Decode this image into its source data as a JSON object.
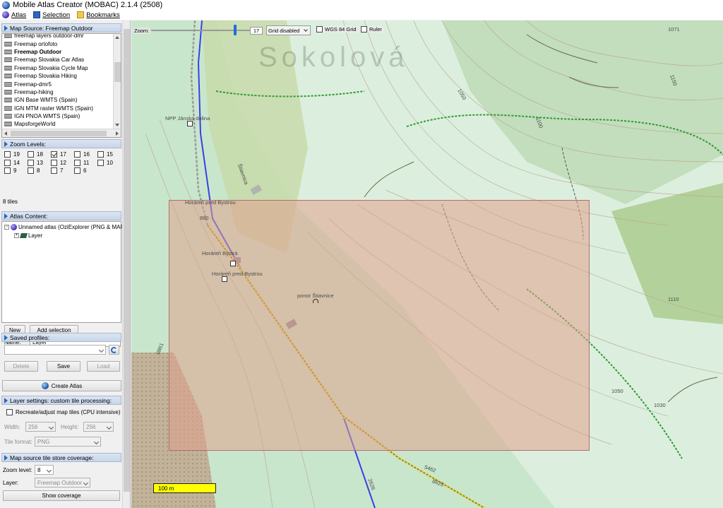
{
  "window": {
    "title": "Mobile Atlas Creator (MOBAC) 2.1.4 (2508)"
  },
  "menu": [
    {
      "label": "Atlas",
      "icon": "globe-icon"
    },
    {
      "label": "Selection",
      "icon": "selection-icon"
    },
    {
      "label": "Bookmarks",
      "icon": "bookmarks-icon"
    }
  ],
  "map_source": {
    "header": "Map Source: Freemap Outdoor",
    "items": [
      "freemap layers outdoor-dmr",
      "Freemap ortofoto",
      "Freemap Outdoor",
      "Freemap Slovakia Car Atlas",
      "Freemap Slovakia Cycle Map",
      "Freemap Slovakia Hiking",
      "Freemap-dmr5",
      "Freemap-hiking",
      "IGN Base WMTS (Spain)",
      "IGN MTM raster WMTS (Spain)",
      "IGN PNOA WMTS (Spain)",
      "MapsforgeWorld"
    ],
    "selected": "Freemap Outdoor"
  },
  "zoom_levels": {
    "header": "Zoom Levels:",
    "levels": [
      {
        "level": "19",
        "checked": false
      },
      {
        "level": "18",
        "checked": false
      },
      {
        "level": "17",
        "checked": true
      },
      {
        "level": "16",
        "checked": false
      },
      {
        "level": "15",
        "checked": false
      },
      {
        "level": "14",
        "checked": false
      },
      {
        "level": "13",
        "checked": false
      },
      {
        "level": "12",
        "checked": false
      },
      {
        "level": "11",
        "checked": false
      },
      {
        "level": "10",
        "checked": false
      },
      {
        "level": "9",
        "checked": false
      },
      {
        "level": "8",
        "checked": false
      },
      {
        "level": "7",
        "checked": false
      },
      {
        "level": "6",
        "checked": false
      }
    ],
    "tiles_text": "8 tiles"
  },
  "atlas_content": {
    "header": "Atlas Content:",
    "atlas_name": "Unnamed atlas (OziExplorer (PNG & MAP",
    "layer_node": "Layer",
    "new_button": "New",
    "add_selection_button": "Add selection",
    "name_label": "Name:",
    "name_value": "Layer"
  },
  "saved_profiles": {
    "header": "Saved profiles:",
    "profile_value": "",
    "delete_button": "Delete",
    "save_button": "Save",
    "load_button": "Load"
  },
  "create_atlas_button": "Create Atlas",
  "layer_settings": {
    "header": "Layer settings: custom tile processing:",
    "recreate_label": "Recreate/adjust map tiles (CPU intensive)",
    "width_label": "Width:",
    "width_value": "256",
    "height_label": "Height:",
    "height_value": "256",
    "tile_format_label": "Tile format:",
    "tile_format_value": "PNG"
  },
  "coverage": {
    "header": "Map source tile store coverage:",
    "zoom_label": "Zoom level:",
    "zoom_value": "8",
    "layer_label": "Layer:",
    "layer_value": "Freemap Outdoor",
    "show_button": "Show coverage"
  },
  "map": {
    "zoom_label": "Zoom:",
    "zoom_value": "17",
    "zoom_fraction": 0.85,
    "grid_value": "Grid disabled",
    "wgs_label": "WGS 84 Grid",
    "ruler_label": "Ruler",
    "scale_text": "100 m",
    "labels": [
      {
        "text": "NPP Jánska dolina"
      },
      {
        "text": "Horáreň pred Bystrou"
      },
      {
        "text": "880"
      },
      {
        "text": "Horáreň Bystrá"
      },
      {
        "text": "Horáreň pred Bystrou"
      },
      {
        "text": "ponor Štiavnice"
      },
      {
        "text": "Štiavnica"
      },
      {
        "text": "1050"
      },
      {
        "text": "1100"
      },
      {
        "text": "1150"
      },
      {
        "text": "1110"
      },
      {
        "text": "1050"
      },
      {
        "text": "1030"
      },
      {
        "text": "1071"
      },
      {
        "text": "0861"
      },
      {
        "text": "8625"
      },
      {
        "text": "5462"
      },
      {
        "text": "2626"
      },
      {
        "text": "Sokolová"
      }
    ]
  },
  "colors": {
    "selection_fill": "#e0a08c",
    "scale_bar": "#ffff00",
    "accent": "#1d6fd6"
  }
}
